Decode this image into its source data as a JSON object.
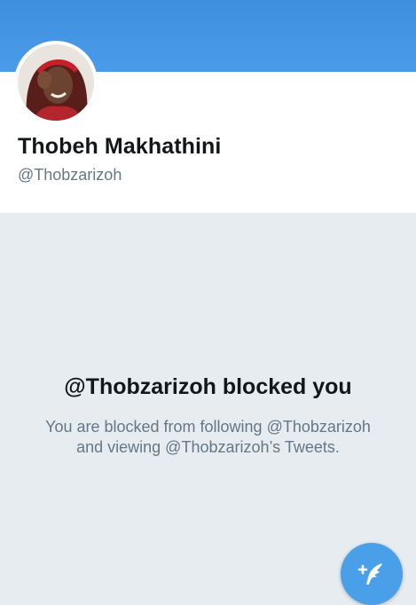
{
  "profile": {
    "display_name": "Thobeh Makhathini",
    "handle": "@Thobzarizoh",
    "avatar_icon": "profile-photo"
  },
  "blocked": {
    "title": "@Thobzarizoh blocked you",
    "message": "You are blocked from following @Thobzarizoh and viewing @Thobzarizoh’s Tweets."
  },
  "compose": {
    "icon": "compose-tweet-icon"
  },
  "colors": {
    "banner": "#4a9bea",
    "background": "#e6ecf0",
    "accent": "#4a9fe9",
    "text_primary": "#14171a",
    "text_secondary": "#657786"
  }
}
